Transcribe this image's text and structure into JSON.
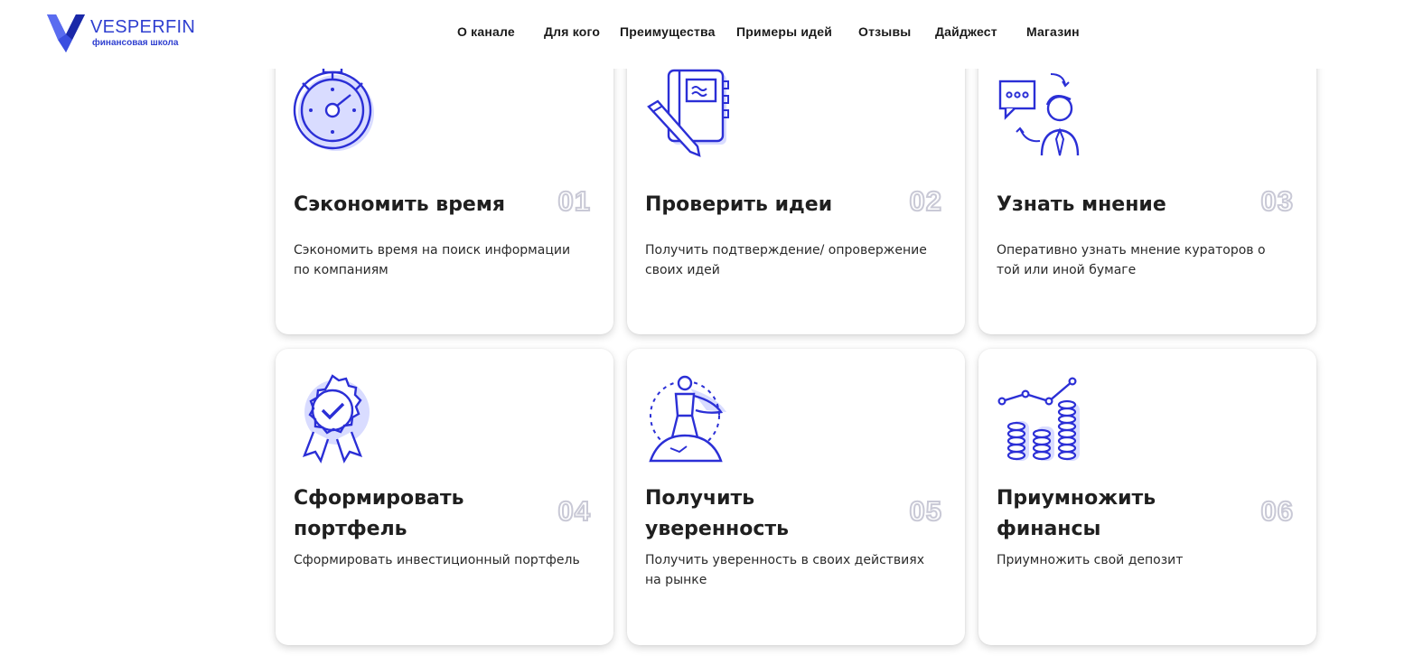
{
  "brand": {
    "name": "VESPERFIN",
    "tagline": "финансовая школа",
    "color": "#2f3fd0"
  },
  "nav": [
    {
      "label": "О канале"
    },
    {
      "label": "Для кого"
    },
    {
      "label": "Преимущества"
    },
    {
      "label": "Примеры идей"
    },
    {
      "label": "Отзывы"
    },
    {
      "label": "Дайджест"
    },
    {
      "label": "Магазин"
    }
  ],
  "cards": [
    {
      "num": "01",
      "title": "Сэкономить время",
      "desc": "Сэкономить время на поиск информации по компаниям",
      "icon": "stopwatch-icon"
    },
    {
      "num": "02",
      "title": "Проверить идеи",
      "desc": "Получить подтверждение/ опровержение своих идей",
      "icon": "notebook-icon"
    },
    {
      "num": "03",
      "title": "Узнать мнение",
      "desc": "Оперативно узнать мнение кураторов о той или иной бумаге",
      "icon": "person-chat-icon"
    },
    {
      "num": "04",
      "title": "Сформировать портфель",
      "desc": "Сформировать инвестиционный портфель",
      "icon": "award-badge-icon"
    },
    {
      "num": "05",
      "title": "Получить уверенность",
      "desc": "Получить уверенность в своих действиях на рынке",
      "icon": "superhero-icon"
    },
    {
      "num": "06",
      "title": "Приумножить финансы",
      "desc": "Приумножить свой депозит",
      "icon": "coins-growth-icon"
    }
  ]
}
